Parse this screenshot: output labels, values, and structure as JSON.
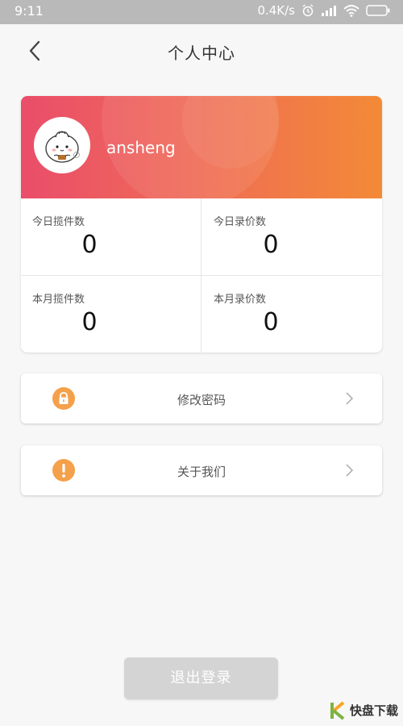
{
  "status_bar": {
    "time": "9:11",
    "network_speed": "0.4K/s",
    "icons": [
      "alarm-icon",
      "signal-icon",
      "wifi-icon",
      "battery-icon"
    ]
  },
  "header": {
    "title": "个人中心",
    "back_icon": "chevron-left-icon"
  },
  "profile": {
    "username": "ansheng",
    "banner_colors": [
      "#ea4d6a",
      "#f38a36"
    ]
  },
  "stats": [
    {
      "label": "今日揽件数",
      "value": "0"
    },
    {
      "label": "今日录价数",
      "value": "0"
    },
    {
      "label": "本月揽件数",
      "value": "0"
    },
    {
      "label": "本月录价数",
      "value": "0"
    }
  ],
  "menu": [
    {
      "label": "修改密码",
      "icon": "lock-icon",
      "icon_color": "#f5a04a"
    },
    {
      "label": "关于我们",
      "icon": "exclamation-icon",
      "icon_color": "#f5a04a"
    }
  ],
  "logout": {
    "label": "退出登录"
  },
  "watermark": {
    "text": "快盘下载"
  }
}
